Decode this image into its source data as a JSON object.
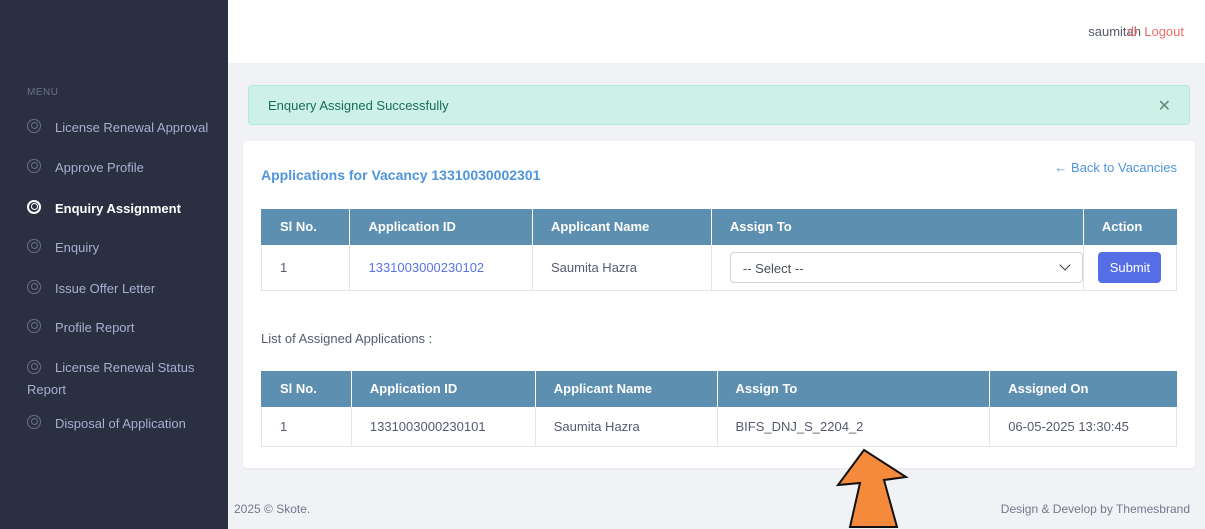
{
  "sidebar": {
    "menu_title": "MENU",
    "items": [
      {
        "label": "License Renewal Approval"
      },
      {
        "label": "Approve Profile"
      },
      {
        "label": "Enquiry Assignment"
      },
      {
        "label": "Enquiry"
      },
      {
        "label": "Issue Offer Letter"
      },
      {
        "label": "Profile Report"
      },
      {
        "label": "License Renewal Status Report"
      },
      {
        "label": "Disposal of Application"
      }
    ]
  },
  "topbar": {
    "username": "saumitah",
    "logout_label": "Logout"
  },
  "alert": {
    "message": "Enquery Assigned Successfully",
    "close_symbol": "✕"
  },
  "card": {
    "title": "Applications for Vacancy 13310030002301",
    "back_link": "← Back to Vacancies"
  },
  "applications_table": {
    "headers": [
      "Sl No.",
      "Application ID",
      "Applicant Name",
      "Assign To",
      "Action"
    ],
    "row": {
      "sl_no": "1",
      "application_id": "1331003000230102",
      "applicant_name": "Saumita Hazra",
      "assign_to_selected": "-- Select --",
      "action_label": "Submit"
    }
  },
  "assigned_heading": "List of Assigned Applications :",
  "assigned_table": {
    "headers": [
      "Sl No.",
      "Application ID",
      "Applicant Name",
      "Assign To",
      "Assigned On"
    ],
    "row": {
      "sl_no": "1",
      "application_id": "1331003000230101",
      "applicant_name": "Saumita Hazra",
      "assign_to": "BIFS_DNJ_S_2204_2",
      "assigned_on": "06-05-2025 13:30:45"
    }
  },
  "footer": {
    "left": "2025 © Skote.",
    "right": "Design & Develop by Themesbrand"
  },
  "colors": {
    "sidebar_bg": "#2a3042",
    "accent_blue": "#556ee6",
    "table_header": "#5d8fb1",
    "alert_bg": "#cdf1e6",
    "logout": "#f46a6a",
    "arrow": "#f58a3c"
  }
}
